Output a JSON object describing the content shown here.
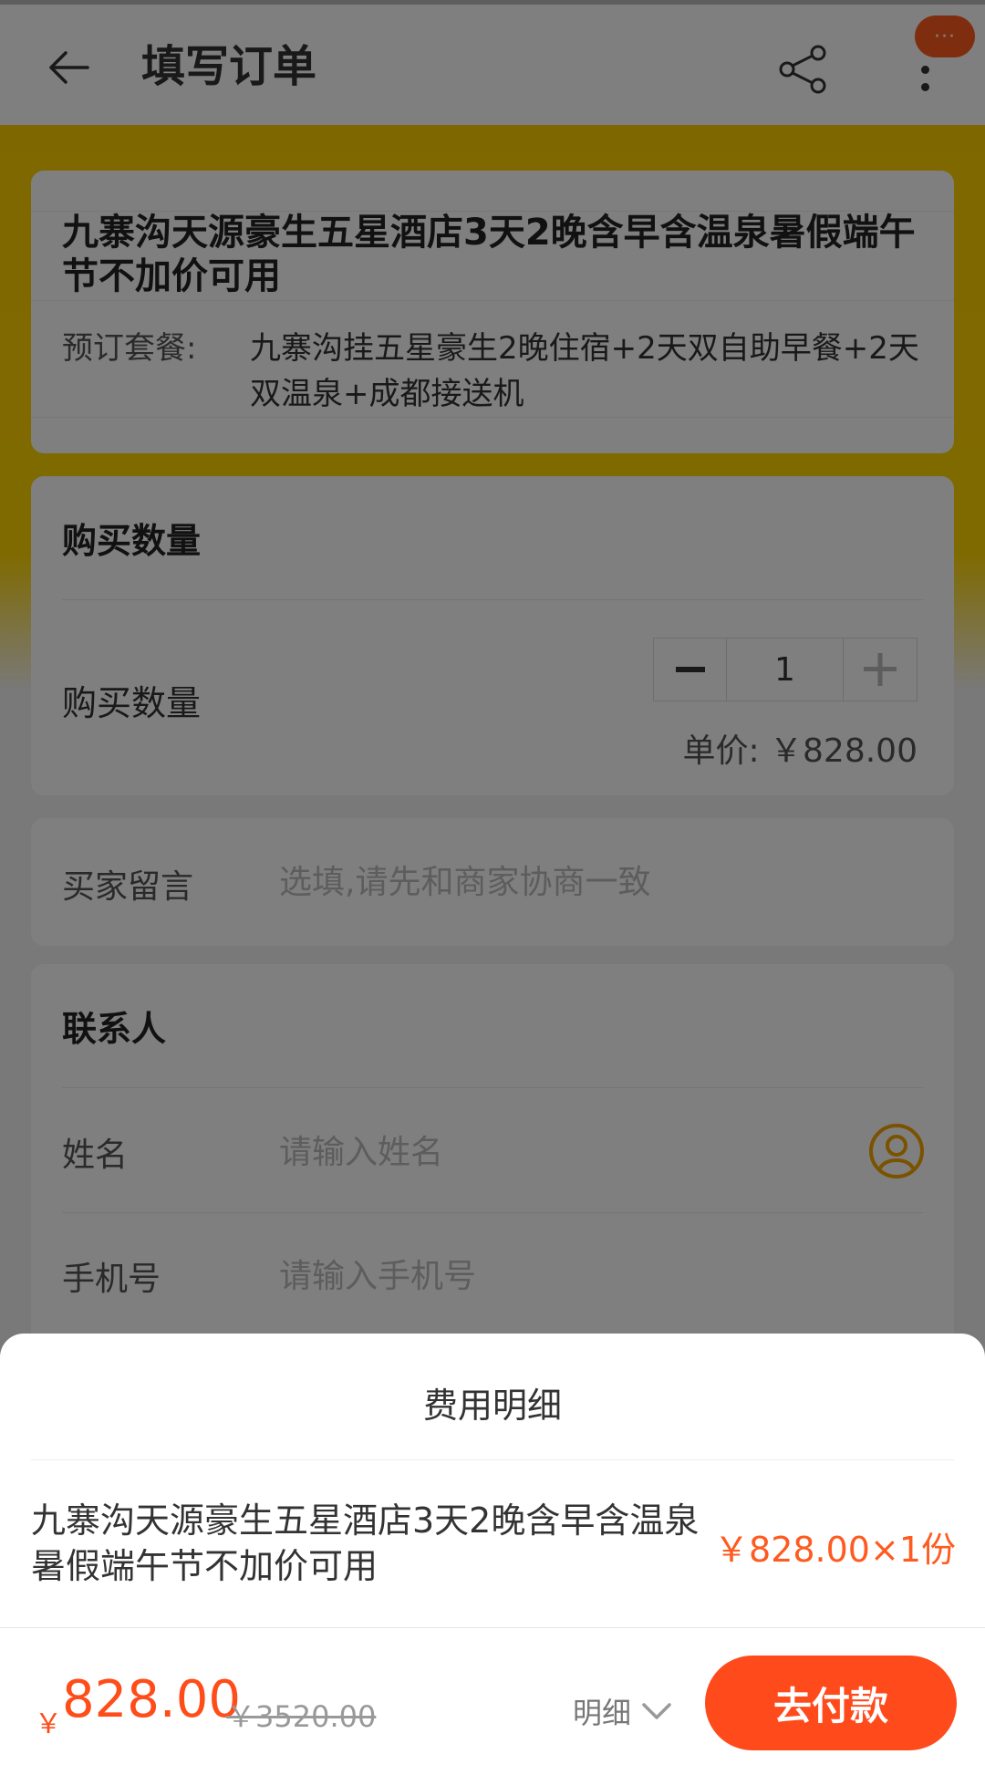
{
  "header": {
    "title": "填写订单",
    "badge": "···"
  },
  "product": {
    "title": "九寨沟天源豪生五星酒店3天2晚含早含温泉暑假端午节不加价可用",
    "package_label": "预订套餐:",
    "package_value": "九寨沟挂五星豪生2晚住宿+2天双自助早餐+2天双温泉+成都接送机"
  },
  "quantity": {
    "section_title": "购买数量",
    "label": "购买数量",
    "value": "1",
    "unit_price": "单价: ￥828.00"
  },
  "message": {
    "label": "买家留言",
    "placeholder": "选填,请先和商家协商一致"
  },
  "contact": {
    "section_title": "联系人",
    "name_label": "姓名",
    "name_placeholder": "请输入姓名",
    "phone_label": "手机号",
    "phone_placeholder": "请输入手机号"
  },
  "fee_sheet": {
    "title": "费用明细",
    "item_name": "九寨沟天源豪生五星酒店3天2晚含早含温泉暑假端午节不加价可用",
    "item_price": "￥828.00×1份"
  },
  "bottom": {
    "currency": "￥",
    "total": "828.00",
    "original": "￥3520.00",
    "detail_label": "明细",
    "pay_label": "去付款"
  },
  "colors": {
    "accent": "#ff4a1c",
    "banner": "#ffd500",
    "icon": "#f5a500"
  },
  "icons": {
    "back": "arrow-left-icon",
    "share": "share-icon",
    "more": "more-vertical-icon",
    "contact": "person-circle-icon",
    "chevron": "chevron-down-icon"
  }
}
